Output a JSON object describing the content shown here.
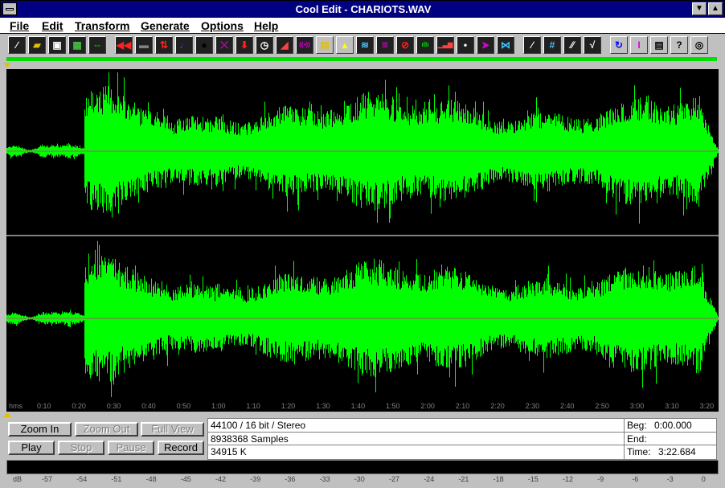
{
  "window": {
    "title": "Cool Edit - CHARIOTS.WAV"
  },
  "title_buttons": [
    "▼",
    "▲"
  ],
  "menu": [
    {
      "label": "File",
      "name": "menu-file"
    },
    {
      "label": "Edit",
      "name": "menu-edit"
    },
    {
      "label": "Transform",
      "name": "menu-transform"
    },
    {
      "label": "Generate",
      "name": "menu-generate"
    },
    {
      "label": "Options",
      "name": "menu-options"
    },
    {
      "label": "Help",
      "name": "menu-help"
    }
  ],
  "toolbar": [
    {
      "name": "new-file-icon",
      "glyph": "∕",
      "color": "#ffffff"
    },
    {
      "name": "open-file-icon",
      "glyph": "▰",
      "color": "#e0c000"
    },
    {
      "name": "save-file-icon",
      "glyph": "▣",
      "color": "#ffffff"
    },
    {
      "name": "waveform-icon",
      "glyph": "▦",
      "color": "#40c040"
    },
    {
      "name": "waveform-edit-icon",
      "glyph": "⇔",
      "color": "#00e000"
    },
    {
      "name": "rewind-icon",
      "glyph": "◀◀",
      "color": "#ff2020"
    },
    {
      "name": "silence-icon",
      "glyph": "▬",
      "color": "#808080"
    },
    {
      "name": "reverse-icon",
      "glyph": "⇅",
      "color": "#ff2020"
    },
    {
      "name": "music-note-icon",
      "glyph": "♩",
      "color": "#4040ff"
    },
    {
      "name": "black-dot-icon",
      "glyph": "●",
      "color": "#000000"
    },
    {
      "name": "crossfade-icon",
      "glyph": "⤬",
      "color": "#e000e0"
    },
    {
      "name": "download-icon",
      "glyph": "⬇",
      "color": "#ff2020"
    },
    {
      "name": "stopwatch-icon",
      "glyph": "◷",
      "color": "#ffffff"
    },
    {
      "name": "color-spectrum-icon",
      "glyph": "◢",
      "color": "#ff4040"
    },
    {
      "name": "radio-icon",
      "glyph": "((•))",
      "color": "#e000e0"
    },
    {
      "name": "folder-icon",
      "glyph": "▤",
      "color": "#e0c000"
    },
    {
      "name": "graph-icon",
      "glyph": "▴",
      "color": "#ffff00"
    },
    {
      "name": "wave-lines-icon",
      "glyph": "≋",
      "color": "#40c0ff"
    },
    {
      "name": "bars-icon",
      "glyph": "|||",
      "color": "#e000e0"
    },
    {
      "name": "no-symbol-icon",
      "glyph": "⊘",
      "color": "#ff2020"
    },
    {
      "name": "equalizer-icon",
      "glyph": "ıllı",
      "color": "#00e000"
    },
    {
      "name": "level-bars-icon",
      "glyph": "▁▃▆",
      "color": "#ff4040"
    },
    {
      "name": "dot-icon",
      "glyph": "•",
      "color": "#ffffff"
    },
    {
      "name": "arrow-right-icon",
      "glyph": "➤",
      "color": "#e000e0"
    },
    {
      "name": "pinch-icon",
      "glyph": "⋈",
      "color": "#40c0ff"
    },
    {
      "name": "line-icon",
      "glyph": "∕",
      "color": "#ffffff"
    },
    {
      "name": "hash-icon",
      "glyph": "#",
      "color": "#40c0ff"
    },
    {
      "name": "slash-lines-icon",
      "glyph": "⁄⁄",
      "color": "#ffffff"
    },
    {
      "name": "check-wave-icon",
      "glyph": "√",
      "color": "#ffffff"
    },
    {
      "name": "refresh-icon",
      "glyph": "↻",
      "color": "#0000ff"
    },
    {
      "name": "cursor-icon",
      "glyph": "I",
      "color": "#e000e0"
    },
    {
      "name": "notepad-icon",
      "glyph": "▤",
      "color": "#000000"
    },
    {
      "name": "help-question-icon",
      "glyph": "?",
      "color": "#000000"
    },
    {
      "name": "cd-icon",
      "glyph": "◎",
      "color": "#000000"
    }
  ],
  "waveform": {
    "channels": 2,
    "wave_color": "#00ff00",
    "center_line_color": "#a06060",
    "divider_color": "#808080"
  },
  "ruler": {
    "unit": "hms",
    "ticks": [
      "0:10",
      "0:20",
      "0:30",
      "0:40",
      "0:50",
      "1:00",
      "1:10",
      "1:20",
      "1:30",
      "1:40",
      "1:50",
      "2:00",
      "2:10",
      "2:20",
      "2:30",
      "2:40",
      "2:50",
      "3:00",
      "3:10",
      "3:20"
    ]
  },
  "controls": {
    "zoom_in": "Zoom In",
    "zoom_out": "Zoom Out",
    "full_view": "Full View",
    "play": "Play",
    "stop": "Stop",
    "pause": "Pause",
    "record": "Record"
  },
  "info": {
    "format": "44100 / 16 bit / Stereo",
    "samples": "8938368 Samples",
    "size": "34915 K",
    "beg_label": "Beg:",
    "beg_value": "0:00.000",
    "end_label": "End:",
    "end_value": "",
    "time_label": "Time:",
    "time_value": "3:22.684"
  },
  "vu_meter": {
    "unit": "dB",
    "ticks": [
      "-57",
      "-54",
      "-51",
      "-48",
      "-45",
      "-42",
      "-39",
      "-36",
      "-33",
      "-30",
      "-27",
      "-24",
      "-21",
      "-18",
      "-15",
      "-12",
      "-9",
      "-6",
      "-3",
      "0"
    ]
  }
}
